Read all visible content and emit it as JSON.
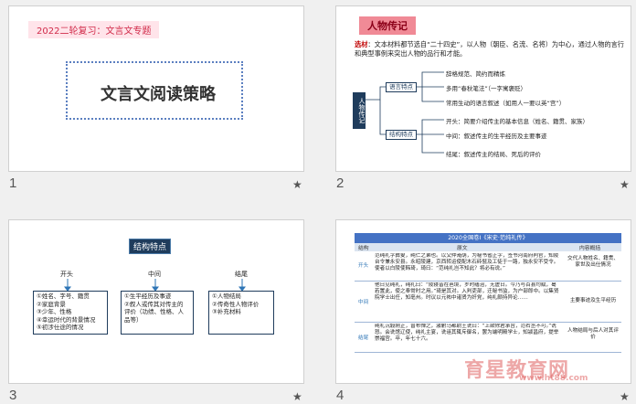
{
  "slides": [
    {
      "num": "1",
      "tag": "2022二轮复习：文言文专题",
      "title": "文言文阅读策略"
    },
    {
      "num": "2",
      "title": "人物传记",
      "intro_kw": "选材",
      "intro_rest": "：文本材料都节选自“二十四史”，以人物（朝臣、名流、名将）为中心，通过人物的言行和典型事例来突出人物的品行和才能。",
      "root": "人物传记",
      "branch_a": "语言特点",
      "branch_b": "结构特点",
      "a_items": [
        "辞格规范、简约而精炼",
        "多用“春秋笔法”（一字寓褒贬）",
        "常用生动的语言叙述（如用人一要以英“宫”）"
      ],
      "b_items": [
        "开头：简要介绍传主的基本信息（姓名、籍贯、家族）",
        "中间：叙述传主的生平经历及主要事迹",
        "结尾：叙述传主的结局、死后的评价"
      ]
    },
    {
      "num": "3",
      "title": "结构特点",
      "heads": [
        "开头",
        "中间",
        "结尾"
      ],
      "boxes": [
        [
          "①姓名、字号、籍贯",
          "②家庭背景",
          "③少年、性格",
          "④幸运时代的背景情况",
          "⑤初涉仕途的情况"
        ],
        [
          "①生平经历及事迹",
          "②叙人或传其对传主的",
          "评价（功绩、性格、人",
          "品等）"
        ],
        [
          "①人物结局",
          "②传奇性人物评价",
          "③补充材料"
        ]
      ]
    },
    {
      "num": "4",
      "table_title": "2020全国卷Ⅰ《宋史·范纯礼传》",
      "columns": [
        "结构",
        "原文",
        "内容概括"
      ],
      "rows": [
        {
          "label": "开头",
          "text": "范纯礼字彝叟，纯仁之弟也。以父仲淹荫，为秘书省正字，签书河南府判官，知陵台令兼永安县。永昭陵建，京西转运使配木石砖甓及工徒于一路，独永安不受令。使者以白陵使韩琦，琦曰：“范纯礼岂不知此？将必有说。”",
          "summary": "交代人物姓名、籍贯、家世及出仕情况"
        },
        {
          "label": "中间",
          "text": "他日见纯礼，纯礼曰：“陵寝皆在邑境，岁时缮治，无虚日。今乃与百县均赋，曷若置此，使之奉常时之用。”琦是其对。入判吏部，迁秘书监，为户部郎中。以集贤院学士出任，知亳州。时议以元祐中诸贤为奸党，纯礼颇持异论……",
          "summary": "主要事迹及生平经历"
        },
        {
          "label": "结尾",
          "text": "纯礼沉毅刚正，曾布惮之，激駙马都尉王诜曰：“上欲除君承旨，范右丞不可。”诜怒。会诜馆辽使，纯礼主宴，诜诬其辄斥御名，罢为端明殿学士，知颍昌府，提举崇福宫。卒，年七十六。",
          "summary": "人物结局与后人对其评价"
        }
      ]
    }
  ],
  "star": "★",
  "watermark_cn": "育星教育网",
  "watermark_url": "www.ht88.com"
}
